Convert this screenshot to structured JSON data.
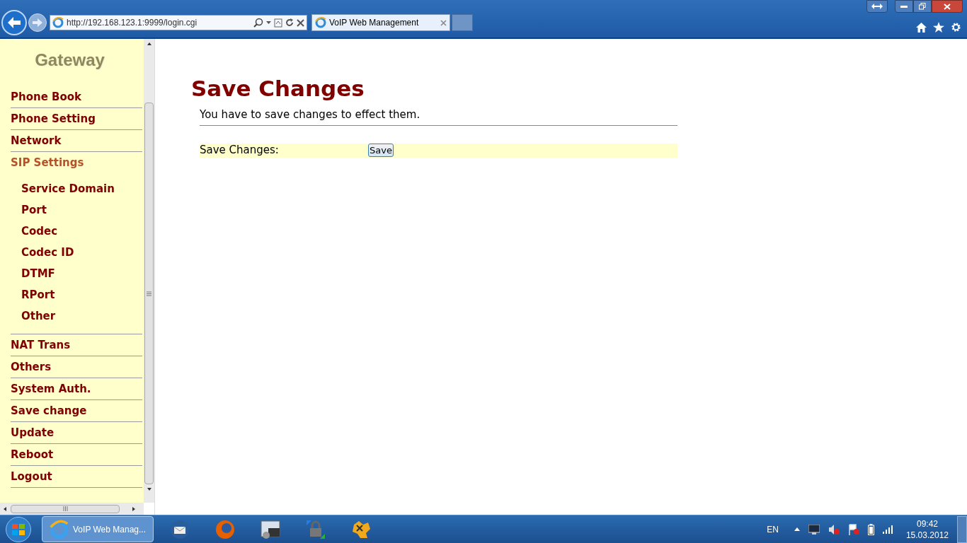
{
  "browser": {
    "url": "http://192.168.123.1:9999/login.cgi",
    "tab": {
      "title": "VoIP Web Management",
      "selected": true
    }
  },
  "sidebar": {
    "logo_text": "Gateway",
    "items": [
      {
        "label": "Phone Book",
        "selected": false
      },
      {
        "label": "Phone Setting",
        "selected": false
      },
      {
        "label": "Network",
        "selected": false
      },
      {
        "label": "SIP Settings",
        "selected": true,
        "children": [
          {
            "label": "Service Domain",
            "selected": false
          },
          {
            "label": "Port",
            "selected": false
          },
          {
            "label": "Codec",
            "selected": false
          },
          {
            "label": "Codec ID",
            "selected": false
          },
          {
            "label": "DTMF",
            "selected": false
          },
          {
            "label": "RPort",
            "selected": false
          },
          {
            "label": "Other",
            "selected": false
          }
        ]
      },
      {
        "label": "NAT Trans",
        "selected": false
      },
      {
        "label": "Others",
        "selected": false
      },
      {
        "label": "System Auth.",
        "selected": false
      },
      {
        "label": "Save change",
        "selected": false
      },
      {
        "label": "Update",
        "selected": false
      },
      {
        "label": "Reboot",
        "selected": false
      },
      {
        "label": "Logout",
        "selected": false
      }
    ]
  },
  "content": {
    "title": "Save Changes",
    "note": "You have to save changes to effect them.",
    "rows": [
      {
        "label": "Save Changes:",
        "button": "Save"
      }
    ]
  },
  "taskbar": {
    "active_window": "VoIP Web Manag...",
    "language": "EN",
    "time": "09:42",
    "date": "15.03.2012"
  }
}
